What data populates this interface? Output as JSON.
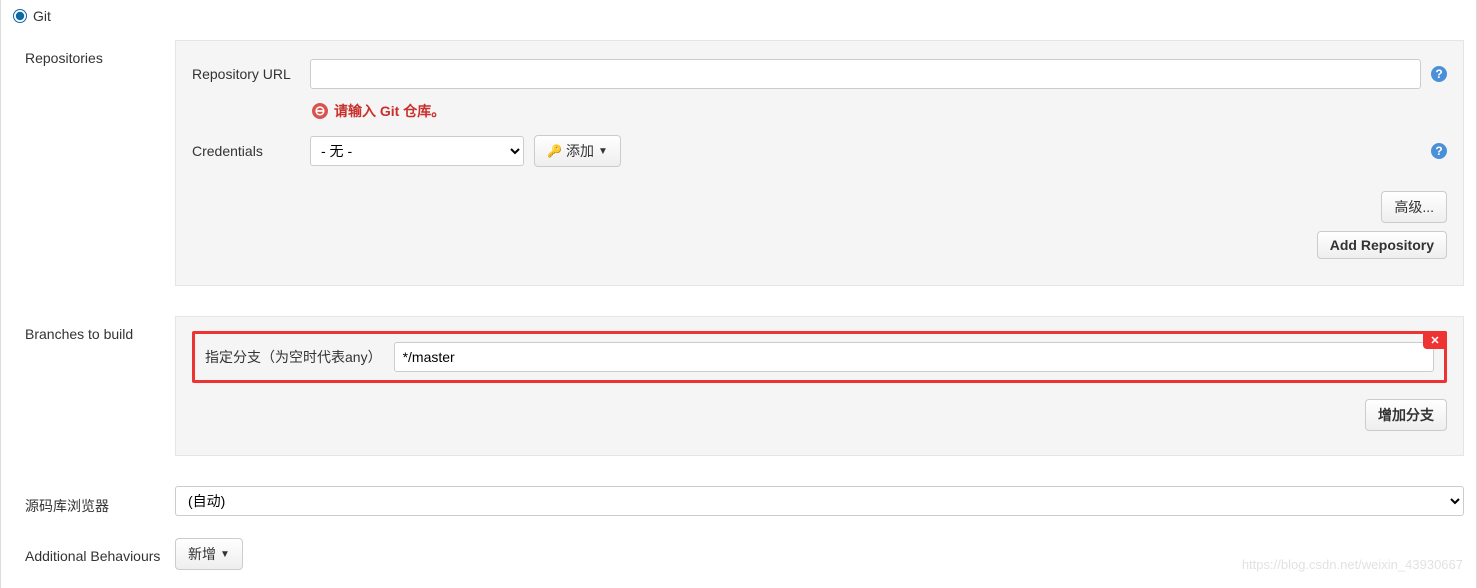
{
  "scm": {
    "radio_label": "Git"
  },
  "repositories": {
    "section_label": "Repositories",
    "url_label": "Repository URL",
    "url_value": "",
    "error_text": "请输入 Git 仓库。",
    "credentials_label": "Credentials",
    "credentials_selected": "- 无 -",
    "add_credentials_label": "添加",
    "advanced_label": "高级...",
    "add_repository_label": "Add Repository"
  },
  "branches": {
    "section_label": "Branches to build",
    "specifier_label": "指定分支（为空时代表any）",
    "specifier_value": "*/master",
    "add_branch_label": "增加分支"
  },
  "repo_browser": {
    "section_label": "源码库浏览器",
    "selected": "(自动)"
  },
  "additional": {
    "section_label": "Additional Behaviours",
    "add_label": "新增"
  },
  "watermark": "https://blog.csdn.net/weixin_43930667"
}
